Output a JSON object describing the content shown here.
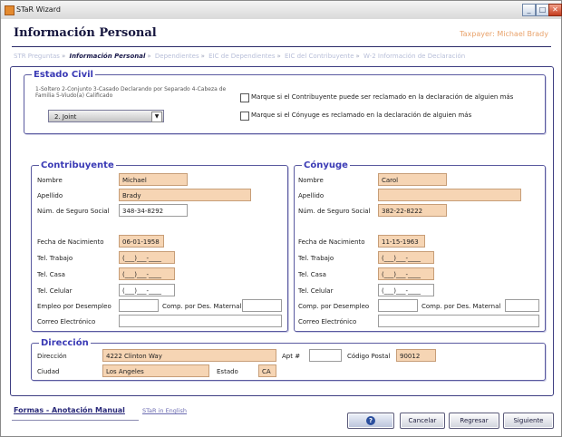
{
  "window": {
    "title": "STaR Wizard",
    "minimize": "_",
    "maximize": "□",
    "close": "✕"
  },
  "header": {
    "title": "Información Personal",
    "taxpayer": "Taxpayer: Michael Brady"
  },
  "breadcrumb": {
    "items": [
      {
        "label": "STR Preguntas"
      },
      {
        "label": "Información Personal",
        "current": true
      },
      {
        "label": "Dependientes"
      },
      {
        "label": "EIC de Dependientes"
      },
      {
        "label": "EIC del Contribuyente"
      },
      {
        "label": "W-2 Información de Declaración"
      }
    ],
    "separator": "»"
  },
  "estado_civil": {
    "legend": "Estado Civil",
    "options_hint": "1-Soltero 2-Conjunto 3-Casado Declarando por Separado 4-Cabeza de Familia 5-Viudo(a) Calificado",
    "selected": "2. Joint",
    "check1": "Marque si el Contribuyente puede ser reclamado en la declaración de alguien más",
    "check2": "Marque si el Cónyuge es reclamado en la declaración de alguien más"
  },
  "contribuyente": {
    "legend": "Contribuyente",
    "nombre_label": "Nombre",
    "nombre": "Michael",
    "apellido_label": "Apellido",
    "apellido": "Brady",
    "ssn_label": "Núm. de Seguro Social",
    "ssn": "348-34-8292",
    "dob_label": "Fecha de Nacimiento",
    "dob": "06-01-1958",
    "tel_trabajo_label": "Tel. Trabajo",
    "tel_trabajo": "(___)___-____",
    "tel_casa_label": "Tel. Casa",
    "tel_casa": "(___)___-____",
    "tel_celular_label": "Tel. Celular",
    "tel_celular": "(___)___-____",
    "empleo_label": "Empleo por Desempleo",
    "comp_label": "Comp. por Des. Maternal",
    "correo_label": "Correo Electrónico"
  },
  "conyuge": {
    "legend": "Cónyuge",
    "nombre_label": "Nombre",
    "nombre": "Carol",
    "apellido_label": "Apellido",
    "apellido": "",
    "ssn_label": "Núm. de Seguro Social",
    "ssn": "382-22-8222",
    "dob_label": "Fecha de Nacimiento",
    "dob": "11-15-1963",
    "tel_trabajo_label": "Tel. Trabajo",
    "tel_trabajo": "(___)___-____",
    "tel_casa_label": "Tel. Casa",
    "tel_casa": "(___)___-____",
    "tel_celular_label": "Tel. Celular",
    "tel_celular": "(___)___-____",
    "empleo_label": "Comp. por Desempleo",
    "comp_label": "Comp. por Des. Maternal",
    "correo_label": "Correo Electrónico"
  },
  "direccion": {
    "legend": "Dirección",
    "direccion_label": "Dirección",
    "direccion": "4222 Clinton Way",
    "apt_label": "Apt #",
    "apt": "",
    "zip_label": "Código Postal",
    "zip": "90012",
    "ciudad_label": "Ciudad",
    "ciudad": "Los Angeles",
    "estado_label": "Estado",
    "estado": "CA"
  },
  "footer": {
    "link": "Formas - Anotación Manual",
    "link2": "STaR in English",
    "help": "?",
    "cancel": "Cancelar",
    "back": "Regresar",
    "next": "Siguiente"
  }
}
